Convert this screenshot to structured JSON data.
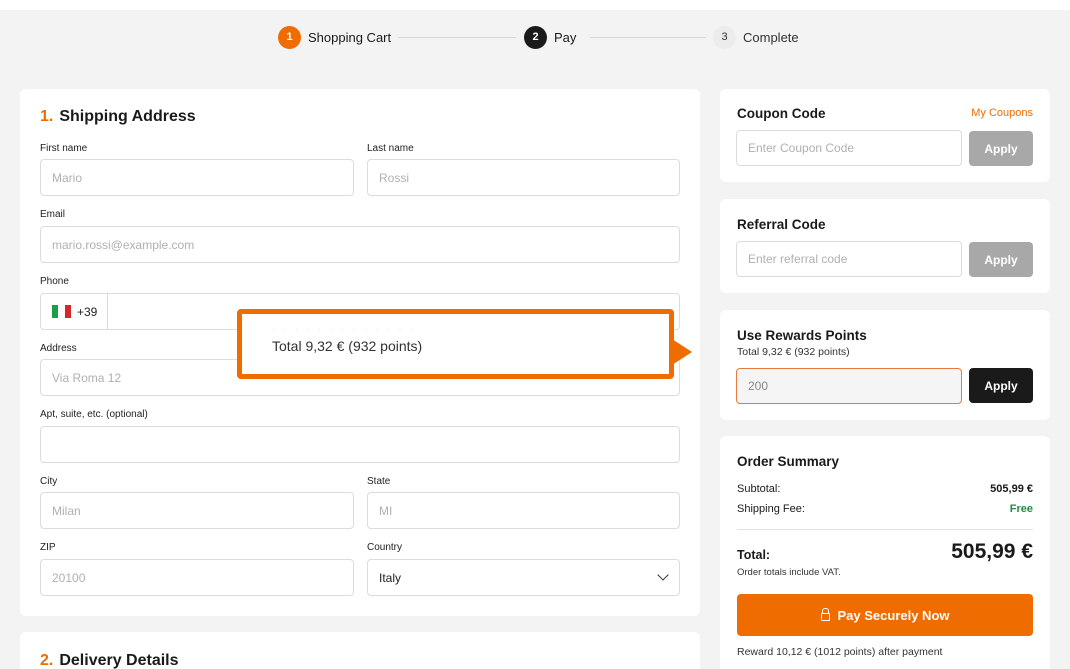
{
  "stepper": {
    "steps": [
      {
        "num": "1",
        "label": "Shopping Cart"
      },
      {
        "num": "2",
        "label": "Pay"
      },
      {
        "num": "3",
        "label": "Complete"
      }
    ]
  },
  "shipping": {
    "index": "1.",
    "title": "Shipping Address",
    "first_name": {
      "label": "First name",
      "placeholder": "Mario"
    },
    "last_name": {
      "label": "Last name",
      "placeholder": "Rossi"
    },
    "email": {
      "label": "Email",
      "placeholder": "mario.rossi@example.com"
    },
    "phone": {
      "label": "Phone",
      "prefix": "+39",
      "flag": "italy-flag-icon"
    },
    "address": {
      "label": "Address",
      "placeholder": "Via Roma 12"
    },
    "apt": {
      "label": "Apt, suite, etc. (optional)",
      "placeholder": ""
    },
    "city": {
      "label": "City",
      "placeholder": "Milan"
    },
    "state": {
      "label": "State",
      "placeholder": "MI"
    },
    "zip": {
      "label": "ZIP",
      "placeholder": "20100"
    },
    "country": {
      "label": "Country",
      "value": "Italy"
    }
  },
  "delivery": {
    "index": "2.",
    "title": "Delivery Details"
  },
  "coupon": {
    "title": "Coupon Code",
    "link": "My Coupons",
    "placeholder": "Enter Coupon Code",
    "button": "Apply"
  },
  "referral": {
    "title": "Referral Code",
    "placeholder": "Enter referral code",
    "button": "Apply"
  },
  "rewards": {
    "title": "Use Rewards Points",
    "subtitle": "Total 9,32 € (932 points)",
    "value": "200",
    "button": "Apply"
  },
  "summary": {
    "title": "Order Summary",
    "subtotal_label": "Subtotal:",
    "subtotal_value": "505,99 €",
    "shipping_label": "Shipping Fee:",
    "shipping_value": "Free",
    "total_label": "Total:",
    "total_value": "505,99 €",
    "vat_note": "Order totals include VAT.",
    "pay_button": "Pay Securely Now",
    "reward_note": "Reward 10,12 € (1012 points) after payment"
  },
  "callout": {
    "text": "Total 9,32 € (932 points)"
  },
  "colors": {
    "accent": "#ef6c00",
    "success": "#1e8e3e",
    "dark": "#1a1a1a"
  }
}
